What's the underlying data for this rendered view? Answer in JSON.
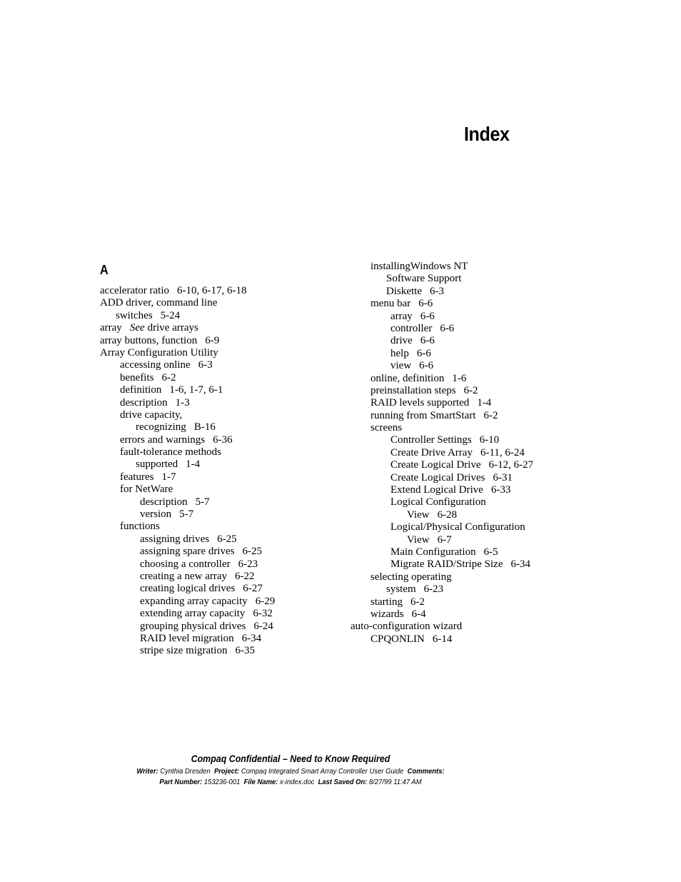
{
  "page_title": "Index",
  "section_letter": "A",
  "left_column": [
    {
      "level": 0,
      "term": "accelerator ratio",
      "pages": "6-10, 6-17, 6-18"
    },
    {
      "level": 0,
      "term": "ADD driver, command line",
      "pages": ""
    },
    {
      "level": 1,
      "cont": true,
      "term": "switches",
      "pages": "5-24"
    },
    {
      "level": 0,
      "term": "array",
      "see": "See",
      "see_target": "drive arrays",
      "pages": ""
    },
    {
      "level": 0,
      "term": "array buttons, function",
      "pages": "6-9"
    },
    {
      "level": 0,
      "term": "Array Configuration Utility",
      "pages": ""
    },
    {
      "level": 1,
      "term": "accessing online",
      "pages": "6-3"
    },
    {
      "level": 1,
      "term": "benefits",
      "pages": "6-2"
    },
    {
      "level": 1,
      "term": "definition",
      "pages": "1-6, 1-7, 6-1"
    },
    {
      "level": 1,
      "term": "description",
      "pages": "1-3"
    },
    {
      "level": 1,
      "term": "drive capacity,",
      "pages": ""
    },
    {
      "level": 2,
      "cont": true,
      "term": "recognizing",
      "pages": "B-16"
    },
    {
      "level": 1,
      "term": "errors and warnings",
      "pages": "6-36"
    },
    {
      "level": 1,
      "term": "fault-tolerance methods",
      "pages": ""
    },
    {
      "level": 2,
      "cont": true,
      "term": "supported",
      "pages": "1-4"
    },
    {
      "level": 1,
      "term": "features",
      "pages": "1-7"
    },
    {
      "level": 1,
      "term": "for NetWare",
      "pages": ""
    },
    {
      "level": 2,
      "term": "description",
      "pages": "5-7"
    },
    {
      "level": 2,
      "term": "version",
      "pages": "5-7"
    },
    {
      "level": 1,
      "term": "functions",
      "pages": ""
    },
    {
      "level": 2,
      "term": "assigning drives",
      "pages": "6-25"
    },
    {
      "level": 2,
      "term": "assigning spare drives",
      "pages": "6-25"
    },
    {
      "level": 2,
      "term": "choosing a controller",
      "pages": "6-23"
    },
    {
      "level": 2,
      "term": "creating a new array",
      "pages": "6-22"
    },
    {
      "level": 2,
      "term": "creating logical drives",
      "pages": "6-27"
    },
    {
      "level": 2,
      "term": "expanding array capacity",
      "pages": "6-29"
    },
    {
      "level": 2,
      "term": "extending array capacity",
      "pages": "6-32"
    },
    {
      "level": 2,
      "term": "grouping physical drives",
      "pages": "6-24"
    },
    {
      "level": 2,
      "term": "RAID level migration",
      "pages": "6-34"
    },
    {
      "level": 2,
      "term": "stripe size migration",
      "pages": "6-35"
    }
  ],
  "right_column": [
    {
      "level": 1,
      "term": "installingWindows NT",
      "pages": ""
    },
    {
      "level": 2,
      "cont": true,
      "term": "Software Support",
      "pages": ""
    },
    {
      "level": 2,
      "cont": true,
      "term": "Diskette",
      "pages": "6-3"
    },
    {
      "level": 1,
      "term": "menu bar",
      "pages": "6-6"
    },
    {
      "level": 2,
      "term": "array",
      "pages": "6-6"
    },
    {
      "level": 2,
      "term": "controller",
      "pages": "6-6"
    },
    {
      "level": 2,
      "term": "drive",
      "pages": "6-6"
    },
    {
      "level": 2,
      "term": "help",
      "pages": "6-6"
    },
    {
      "level": 2,
      "term": "view",
      "pages": "6-6"
    },
    {
      "level": 1,
      "term": "online, definition",
      "pages": "1-6"
    },
    {
      "level": 1,
      "term": "preinstallation steps",
      "pages": "6-2"
    },
    {
      "level": 1,
      "term": "RAID levels supported",
      "pages": "1-4"
    },
    {
      "level": 1,
      "term": "running from SmartStart",
      "pages": "6-2"
    },
    {
      "level": 1,
      "term": "screens",
      "pages": ""
    },
    {
      "level": 2,
      "term": "Controller Settings",
      "pages": "6-10"
    },
    {
      "level": 2,
      "term": "Create Drive Array",
      "pages": "6-11, 6-24"
    },
    {
      "level": 2,
      "term": "Create Logical Drive",
      "pages": "6-12, 6-27"
    },
    {
      "level": 2,
      "term": "Create Logical Drives",
      "pages": "6-31"
    },
    {
      "level": 2,
      "term": "Extend Logical Drive",
      "pages": "6-33"
    },
    {
      "level": 2,
      "term": "Logical Configuration",
      "pages": ""
    },
    {
      "level": 3,
      "cont": true,
      "term": "View",
      "pages": "6-28"
    },
    {
      "level": 2,
      "term": "Logical/Physical Configuration",
      "pages": ""
    },
    {
      "level": 3,
      "cont": true,
      "term": "View",
      "pages": "6-7"
    },
    {
      "level": 2,
      "term": "Main Configuration",
      "pages": "6-5"
    },
    {
      "level": 2,
      "term": "Migrate RAID/Stripe Size",
      "pages": "6-34"
    },
    {
      "level": 1,
      "term": "selecting operating",
      "pages": ""
    },
    {
      "level": 2,
      "cont": true,
      "term": "system",
      "pages": "6-23"
    },
    {
      "level": 1,
      "term": "starting",
      "pages": "6-2"
    },
    {
      "level": 1,
      "term": "wizards",
      "pages": "6-4"
    },
    {
      "level": 0,
      "term": "auto-configuration wizard",
      "pages": ""
    },
    {
      "level": 1,
      "term": "CPQONLIN",
      "pages": "6-14"
    }
  ],
  "footer": {
    "confidential": "Compaq Confidential – Need to Know Required",
    "writer_label": "Writer:",
    "writer": "Cynthia Dresden",
    "project_label": "Project:",
    "project": "Compaq Integrated Smart Array Controller User Guide",
    "comments_label": "Comments:",
    "comments": "",
    "part_number_label": "Part Number:",
    "part_number": "153236-001",
    "file_name_label": "File Name:",
    "file_name": "x-index.doc",
    "last_saved_label": "Last Saved On:",
    "last_saved": "8/27/99 11:47 AM"
  }
}
